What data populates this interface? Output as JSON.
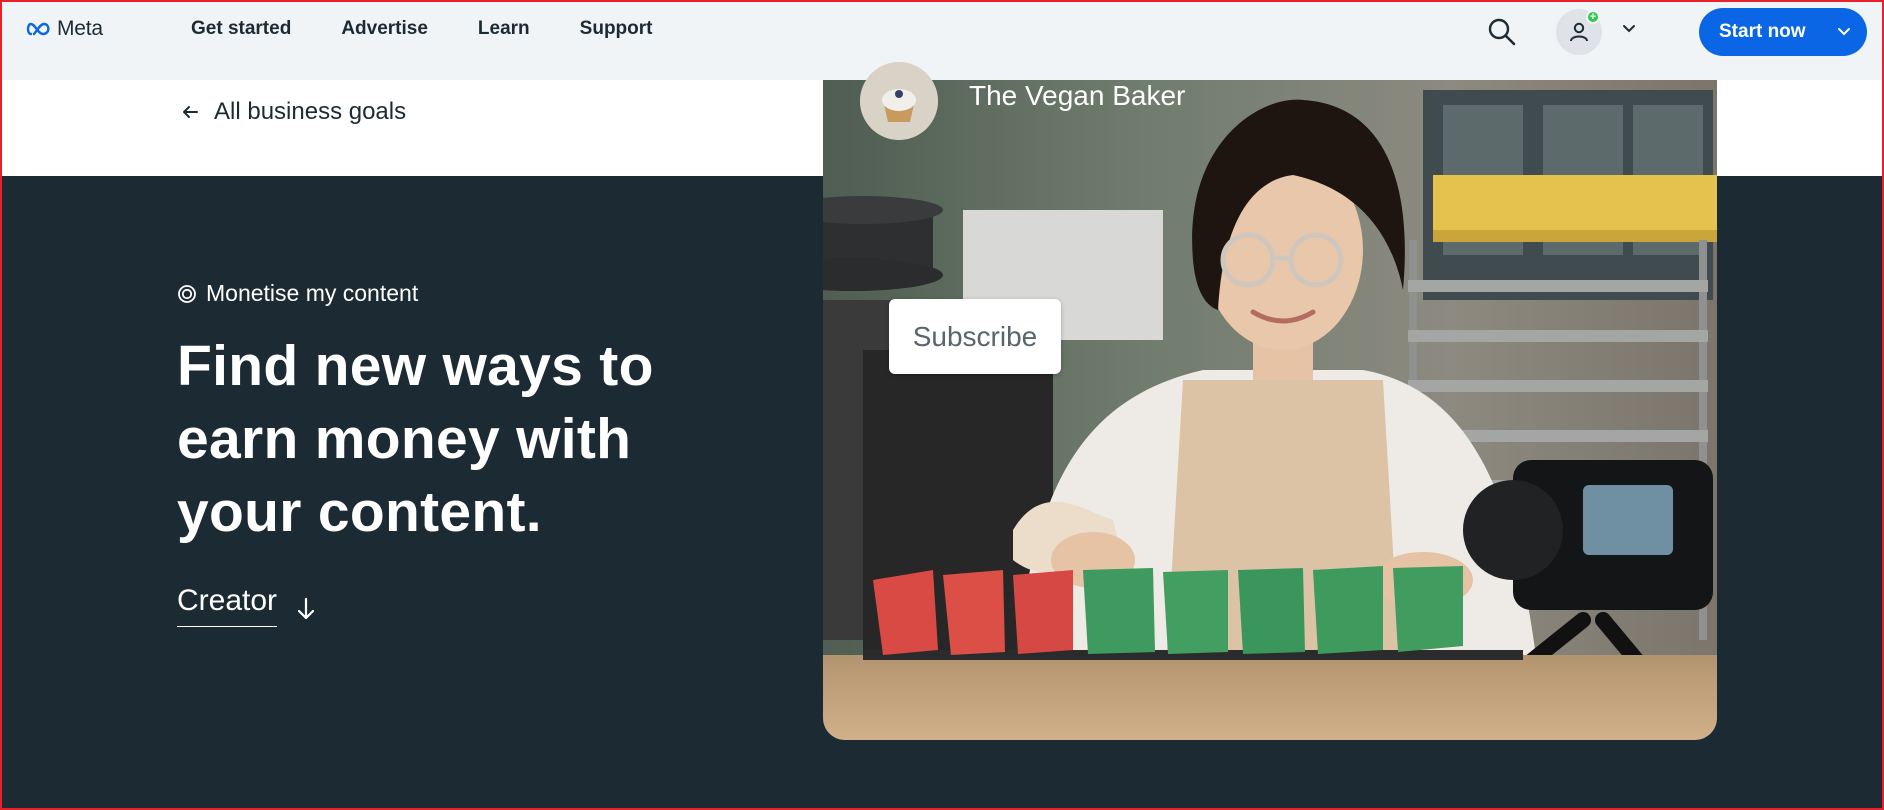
{
  "nav": {
    "logo_text": "Meta",
    "links": [
      "Get started",
      "Advertise",
      "Learn",
      "Support"
    ],
    "search_icon": "search-icon",
    "account_icon": "person-icon",
    "account_badge": "+",
    "cta_label": "Start now"
  },
  "back_link": {
    "label": "All business goals",
    "icon": "arrow-left-icon"
  },
  "hero": {
    "goal_icon": "target-icon",
    "goal_label": "Monetise my content",
    "headline": "Find new ways to earn money with your content.",
    "audience_link": "Creator",
    "audience_icon": "arrow-down-icon"
  },
  "media": {
    "profile_name": "The Vegan Baker",
    "subscribe_label": "Subscribe"
  },
  "colors": {
    "nav_bg": "#f1f4f7",
    "hero_bg": "#1c2b33",
    "primary": "#0a66e4",
    "text_dark": "#1c2b33",
    "badge_green": "#31c94c"
  }
}
